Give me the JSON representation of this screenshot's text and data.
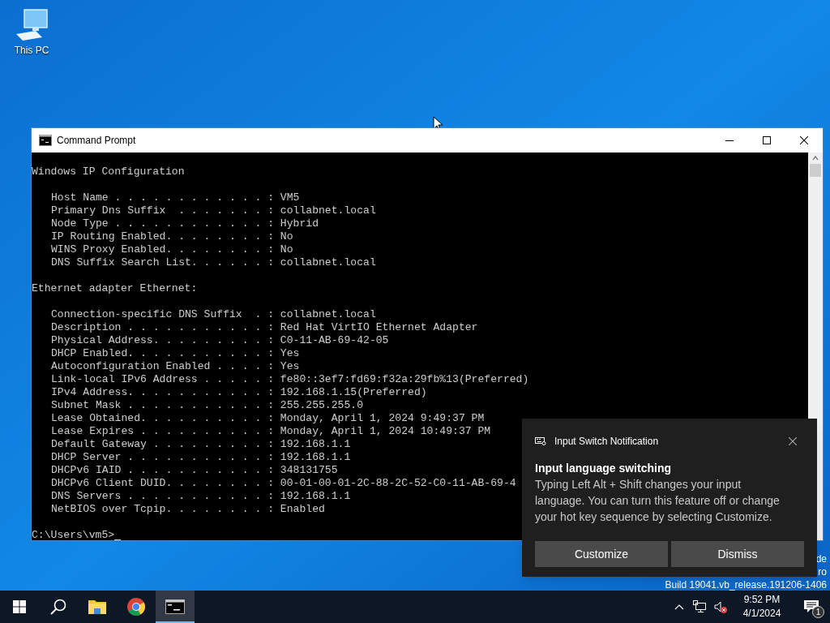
{
  "desktop_icons": [
    {
      "label": "This PC"
    }
  ],
  "console_window": {
    "title": "Command Prompt",
    "sections": [
      {
        "heading": "Windows IP Configuration",
        "lines": [
          "Host Name . . . . . . . . . . . . : VM5",
          "Primary Dns Suffix  . . . . . . . : collabnet.local",
          "Node Type . . . . . . . . . . . . : Hybrid",
          "IP Routing Enabled. . . . . . . . : No",
          "WINS Proxy Enabled. . . . . . . . : No",
          "DNS Suffix Search List. . . . . . : collabnet.local"
        ]
      },
      {
        "heading": "Ethernet adapter Ethernet:",
        "lines": [
          "Connection-specific DNS Suffix  . : collabnet.local",
          "Description . . . . . . . . . . . : Red Hat VirtIO Ethernet Adapter",
          "Physical Address. . . . . . . . . : C0-11-AB-69-42-05",
          "DHCP Enabled. . . . . . . . . . . : Yes",
          "Autoconfiguration Enabled . . . . : Yes",
          "Link-local IPv6 Address . . . . . : fe80::3ef7:fd69:f32a:29fb%13(Preferred)",
          "IPv4 Address. . . . . . . . . . . : 192.168.1.15(Preferred)",
          "Subnet Mask . . . . . . . . . . . : 255.255.255.0",
          "Lease Obtained. . . . . . . . . . : Monday, April 1, 2024 9:49:37 PM",
          "Lease Expires . . . . . . . . . . : Monday, April 1, 2024 10:49:37 PM",
          "Default Gateway . . . . . . . . . : 192.168.1.1",
          "DHCP Server . . . . . . . . . . . : 192.168.1.1",
          "DHCPv6 IAID . . . . . . . . . . . : 348131755",
          "DHCPv6 Client DUID. . . . . . . . : 00-01-00-01-2C-88-2C-52-C0-11-AB-69-4",
          "DNS Servers . . . . . . . . . . . : 192.168.1.1",
          "NetBIOS over Tcpip. . . . . . . . : Enabled"
        ]
      }
    ],
    "prompt": "C:\\Users\\vm5>"
  },
  "notification": {
    "app": "Input Switch Notification",
    "heading": "Input language switching",
    "body": "Typing Left Alt + Shift changes your input language. You can turn this feature off or change your hot key sequence by selecting Customize.",
    "buttons": [
      "Customize",
      "Dismiss"
    ]
  },
  "desktop_watermark": [
    "de",
    "ro",
    "Build 19041.vb_release.191206-1406"
  ],
  "taskbar": {
    "apps": [
      {
        "kind": "start",
        "selected": false
      },
      {
        "kind": "search",
        "selected": false
      },
      {
        "kind": "explorer",
        "selected": false
      },
      {
        "kind": "chrome",
        "selected": false
      },
      {
        "kind": "cmd",
        "selected": true
      }
    ],
    "clock": {
      "time": "9:52 PM",
      "date": "4/1/2024"
    },
    "notification_count": "1"
  }
}
